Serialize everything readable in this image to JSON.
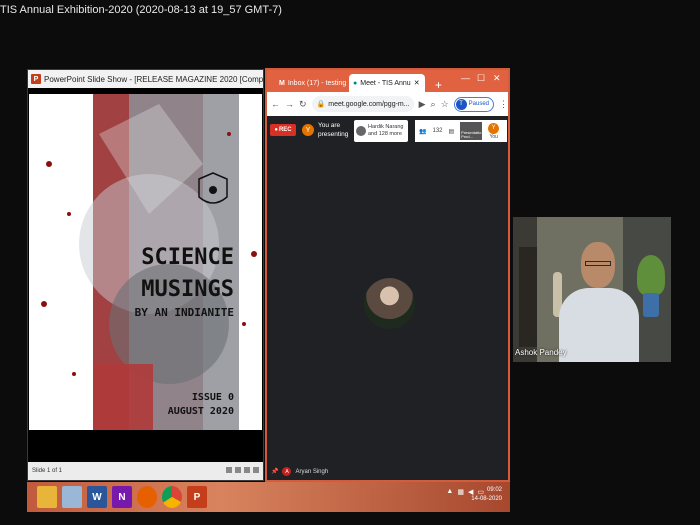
{
  "recording": {
    "title": "TIS Annual Exhibition-2020 (2020-08-13 at 19_57 GMT-7)"
  },
  "powerpoint": {
    "app_icon_letter": "P",
    "window_title": "PowerPoint Slide Show - [RELEASE MAGAZINE 2020 [Compatibili...",
    "status_text": "Slide 1 of 1",
    "slide": {
      "title_line1": "SCIENCE",
      "title_line2": "MUSINGS",
      "subtitle": "BY AN INDIANITE",
      "issue": "ISSUE 0",
      "month": "AUGUST 2020"
    }
  },
  "chrome": {
    "tabs": [
      {
        "label": "Inbox (17) - testing",
        "icon": "gmail-icon"
      },
      {
        "label": "Meet - TIS Annu",
        "icon": "meet-icon"
      }
    ],
    "new_tab_symbol": "+",
    "url": "meet.google.com/pgg-m...",
    "profile_initial": "T",
    "profile_status": "Paused"
  },
  "meet": {
    "rec_label": "REC",
    "presenter_initial": "Y",
    "presenting_text": "You are presenting",
    "participants_summary": "Hardik Narang and 128 more",
    "participants_count": "132",
    "self_view_label": "Presentatio Prod...",
    "you_initial": "Y",
    "you_label": "You",
    "active_speaker": "Aryan Singh",
    "active_speaker_initial": "A"
  },
  "webcam": {
    "name": "Ashok Pandey"
  },
  "taskbar": {
    "apps": [
      {
        "name": "file-explorer-icon",
        "color": "#e8b43a",
        "glyph": ""
      },
      {
        "name": "notepad-icon",
        "color": "#9bb7d8",
        "glyph": ""
      },
      {
        "name": "word-icon",
        "color": "#2b579a",
        "glyph": "W"
      },
      {
        "name": "onenote-icon",
        "color": "#7719aa",
        "glyph": "N"
      },
      {
        "name": "firefox-icon",
        "color": "#e66000",
        "glyph": ""
      },
      {
        "name": "chrome-icon",
        "color": "#4285f4",
        "glyph": ""
      },
      {
        "name": "powerpoint-icon",
        "color": "#c43e1c",
        "glyph": "P"
      }
    ],
    "time": "09:02",
    "date": "14-08-2020"
  }
}
